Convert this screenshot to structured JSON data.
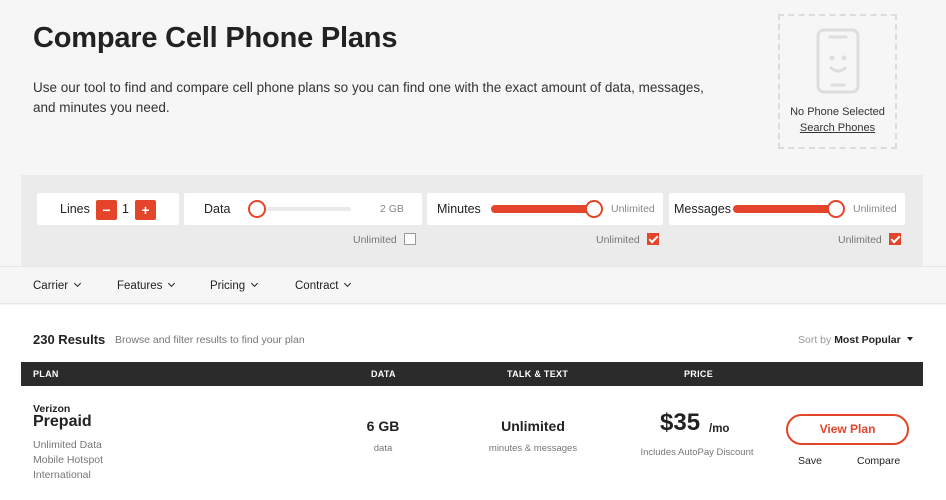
{
  "header": {
    "title": "Compare Cell Phone Plans",
    "intro": "Use our tool to find and compare cell phone plans so you can find one with the exact amount of data, messages, and minutes you need."
  },
  "phone_picker": {
    "status": "No Phone Selected",
    "search_link": "Search Phones",
    "icon": "phone-icon"
  },
  "filters": {
    "lines": {
      "label": "Lines",
      "value": "1",
      "minus": "−",
      "plus": "+"
    },
    "data": {
      "label": "Data",
      "value": "2 GB",
      "unlimited_label": "Unlimited",
      "unlimited_checked": false,
      "slider_level": 0.0
    },
    "minutes": {
      "label": "Minutes",
      "value": "Unlimited",
      "unlimited_label": "Unlimited",
      "unlimited_checked": true,
      "slider_level": 1.0
    },
    "messages": {
      "label": "Messages",
      "value": "Unlimited",
      "unlimited_label": "Unlimited",
      "unlimited_checked": true,
      "slider_level": 1.0
    }
  },
  "menu": {
    "items": [
      "Carrier",
      "Features",
      "Pricing",
      "Contract"
    ]
  },
  "results": {
    "count": "230 Results",
    "hint": "Browse and filter results to find your plan",
    "sort_prefix": "Sort by",
    "sort_value": "Most Popular"
  },
  "table": {
    "headers": [
      "PLAN",
      "DATA",
      "TALK & TEXT",
      "PRICE"
    ]
  },
  "plans": [
    {
      "carrier": "Verizon",
      "name": "Prepaid",
      "features": [
        "Unlimited Data",
        "Mobile Hotspot",
        "International"
      ],
      "data_value": "6 GB",
      "data_sub": "data",
      "talk_value": "Unlimited",
      "talk_sub": "minutes & messages",
      "price": "$35",
      "per": "/mo",
      "price_note": "Includes AutoPay Discount",
      "view_label": "View Plan",
      "save_label": "Save",
      "compare_label": "Compare"
    }
  ],
  "colors": {
    "accent": "#e4452a",
    "header_bar": "#2b2b2b",
    "background": "#f6f6f6"
  }
}
